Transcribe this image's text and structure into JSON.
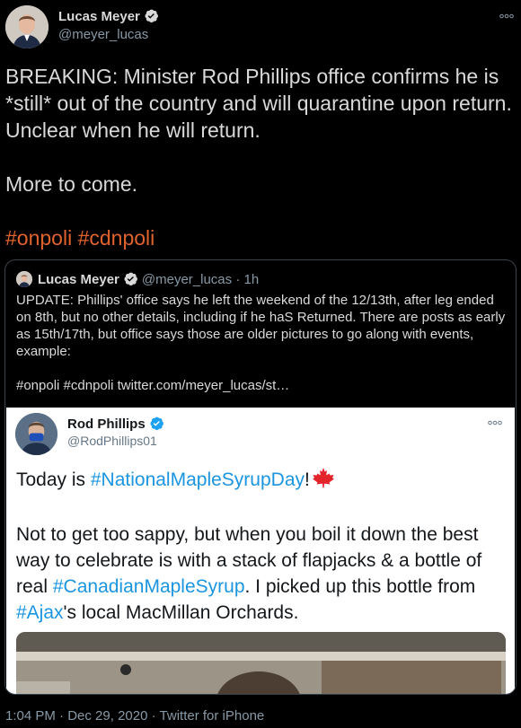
{
  "author": {
    "name": "Lucas Meyer",
    "handle": "@meyer_lucas",
    "verified": true
  },
  "more_icon": "more-dots-icon",
  "tweet": {
    "line1": "BREAKING: Minister Rod Phillips office confirms he is *still* out of the country and will quarantine upon return. Unclear when he will return.",
    "line2": "More to come.",
    "hashtag1": "#onpoli",
    "hashtag2": "#cdnpoli"
  },
  "quoted": {
    "name": "Lucas Meyer",
    "handle": "@meyer_lucas",
    "time": "· 1h",
    "text1": "UPDATE: Phillips' office says he left the weekend of the 12/13th, after leg ended on 8th, but no other details, including if he haS Returned. There are posts as early as 15th/17th, but office says those are older pictures to go along with events, example:",
    "text2": "#onpoli #cdnpoli  twitter.com/meyer_lucas/st…",
    "embedded": {
      "name": "Rod Phillips",
      "handle": "@RodPhillips01",
      "line1_prefix": "Today is ",
      "line1_link": "#NationalMapleSyrupDay",
      "line1_suffix": "!",
      "para2_a": "Not to get too sappy, but when you boil it down the best way to celebrate is with a stack of flapjacks & a bottle of real ",
      "para2_link1": "#CanadianMapleSyrup",
      "para2_b": ". I picked up this bottle from ",
      "para2_link2": "#Ajax",
      "para2_c": "'s local MacMillan Orchards."
    }
  },
  "footer": {
    "time": "1:04 PM",
    "date": "Dec 29, 2020",
    "source": "Twitter for iPhone",
    "separator": "·"
  },
  "colors": {
    "background": "#000000",
    "hashtag": "#e0632e",
    "link": "#1b95e0",
    "verified": "#d9d9d9",
    "muted": "#8899a6"
  }
}
